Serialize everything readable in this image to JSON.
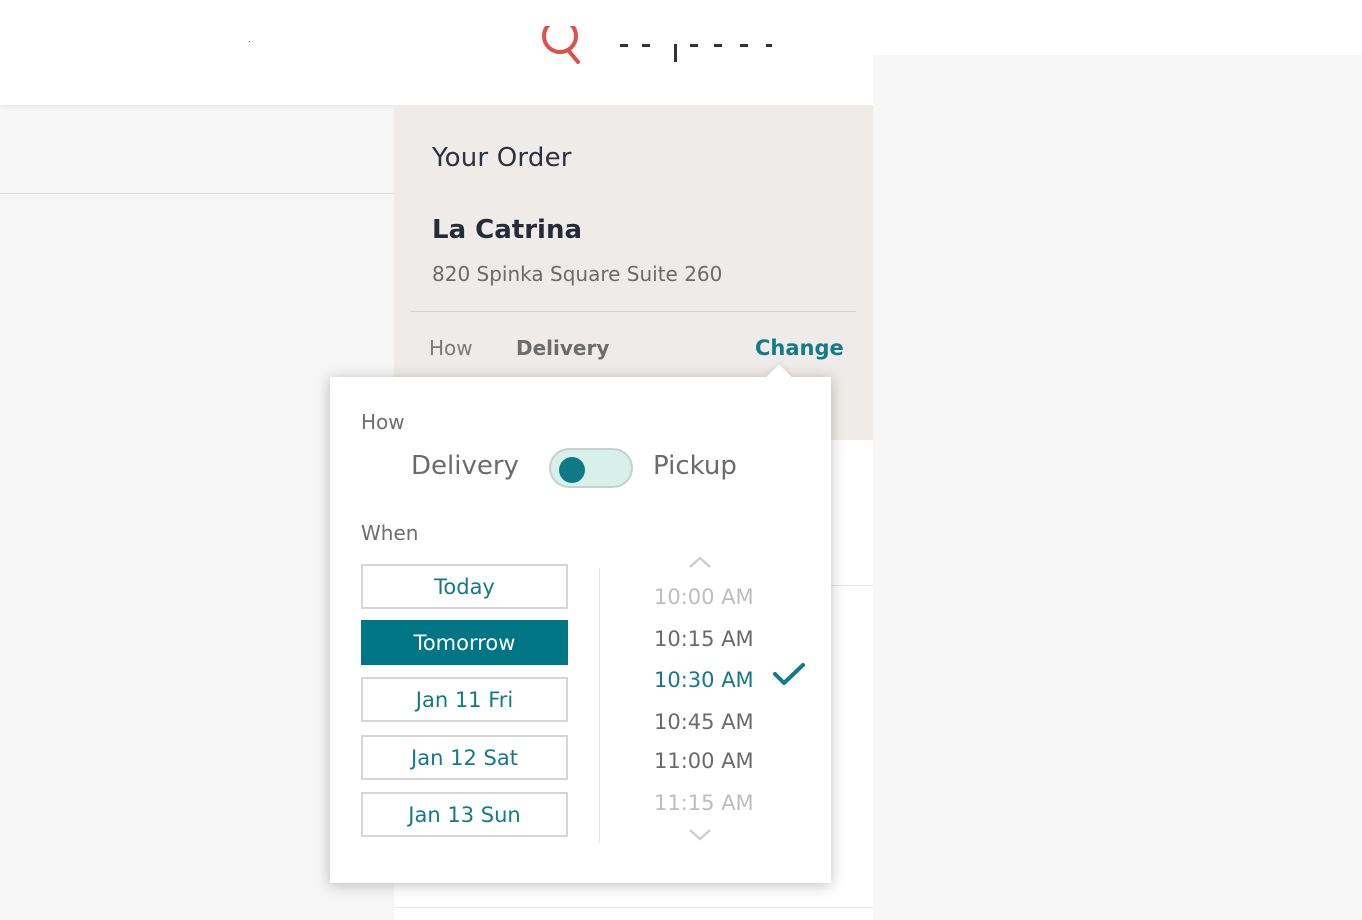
{
  "order": {
    "title": "Your Order",
    "restaurant_name": "La Catrina",
    "restaurant_address": "820 Spinka Square Suite 260",
    "how_label": "How",
    "how_value": "Delivery",
    "change_label": "Change"
  },
  "popover": {
    "how_label": "How",
    "toggle_left": "Delivery",
    "toggle_right": "Pickup",
    "toggle_state": "Delivery",
    "when_label": "When",
    "days": [
      {
        "label": "Today",
        "active": false
      },
      {
        "label": "Tomorrow",
        "active": true
      },
      {
        "label": "Jan 11 Fri",
        "active": false
      },
      {
        "label": "Jan 12 Sat",
        "active": false
      },
      {
        "label": "Jan 13 Sun",
        "active": false
      }
    ],
    "times": [
      {
        "label": "10:00 AM",
        "state": "faded"
      },
      {
        "label": "10:15 AM",
        "state": "normal"
      },
      {
        "label": "10:30 AM",
        "state": "selected"
      },
      {
        "label": "10:45 AM",
        "state": "normal"
      },
      {
        "label": "11:00 AM",
        "state": "normal"
      },
      {
        "label": "11:15 AM",
        "state": "faded"
      }
    ]
  },
  "icons": {
    "logo": "brand-logo-icon",
    "scroll_up": "chevron-up-icon",
    "scroll_down": "chevron-down-icon",
    "selected_time": "checkmark-icon"
  },
  "colors": {
    "accent": "#137a86",
    "active_day_bg": "#007684",
    "order_header_bg": "#efebe8",
    "toggle_track": "#d7f1ea",
    "logo_red": "#e0504a"
  }
}
